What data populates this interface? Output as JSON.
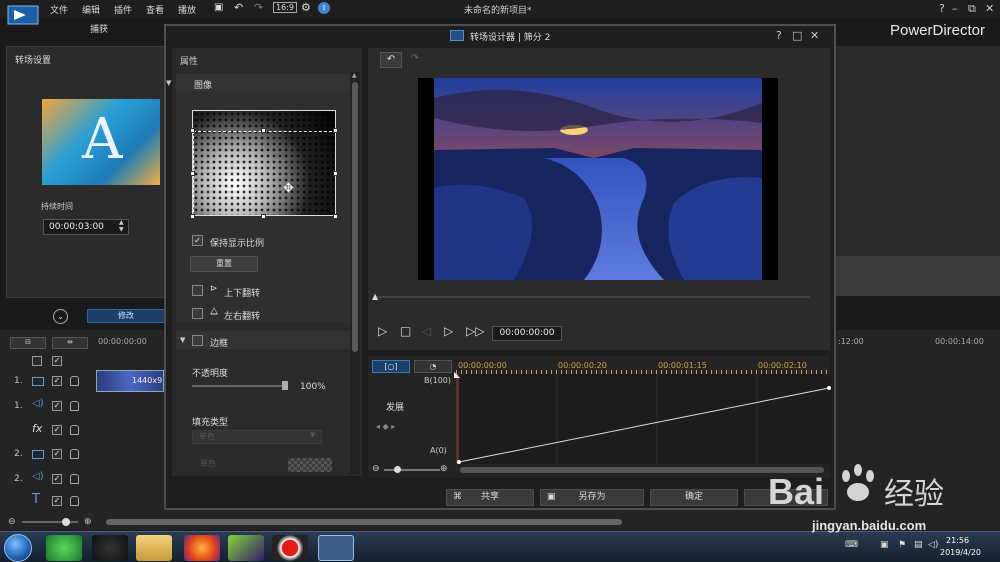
{
  "app": {
    "menu": [
      "文件",
      "编辑",
      "插件",
      "查看",
      "播放"
    ],
    "title": "未命名的新项目*",
    "brand": "PowerDirector",
    "capture_tab": "捕获"
  },
  "left_panel": {
    "title": "转场设置",
    "duration_label": "持续时间",
    "duration_value": "00:00:03:00",
    "modify_label": "修改"
  },
  "dialog": {
    "title": "转场设计器 | 筛分 2",
    "properties_title": "属性",
    "image_section": "图像",
    "keep_aspect": "保持显示比例",
    "reset": "重置",
    "flip_vertical": "上下翻转",
    "flip_horizontal": "左右翻转",
    "border_section": "边框",
    "opacity_label": "不透明度",
    "opacity_value": "100%",
    "fill_type_label": "填充类型",
    "fill_type_value": "单色",
    "single_color_label": "单色",
    "timecode": "00:00:00:00",
    "kf_times": [
      "00:00:00:00",
      "00:00:00:20",
      "00:00:01:15",
      "00:00:02:10"
    ],
    "kf_name": "发展",
    "kf_b": "B(100)",
    "kf_a": "A(0)",
    "buttons": {
      "share": "共享",
      "save_as": "另存为",
      "ok": "确定"
    }
  },
  "timeline": {
    "ruler": [
      "00:00:00:00",
      ":12:00",
      "00:00:14:00"
    ],
    "tracks": [
      "1.",
      "1.",
      "",
      "2.",
      "2.",
      "",
      ""
    ],
    "clip_label": "1440x9"
  },
  "taskbar": {
    "time": "21:56",
    "date": "2019/4/20"
  },
  "watermark": {
    "text": "jingyan.baidu.com"
  }
}
